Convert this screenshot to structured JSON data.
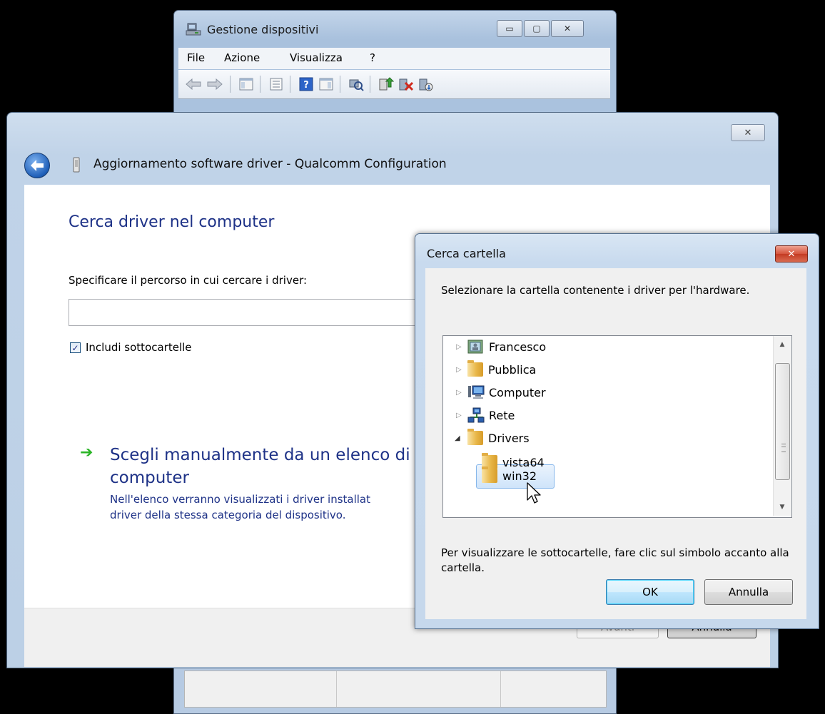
{
  "device_manager": {
    "title": "Gestione dispositivi",
    "menu": [
      "File",
      "Azione",
      "Visualizza",
      "?"
    ],
    "toolbar_icons": [
      "back-icon",
      "forward-icon",
      "console-tree-icon",
      "properties-icon",
      "help-icon",
      "action-pane-icon",
      "scan-hardware-icon",
      "update-driver-icon",
      "disable-device-icon",
      "uninstall-device-icon"
    ]
  },
  "wizard": {
    "title": "Aggiornamento software driver - Qualcomm Configuration",
    "heading": "Cerca driver nel computer",
    "path_label": "Specificare il percorso in cui cercare i driver:",
    "path_value": "",
    "include_subfolders_label": "Includi sottocartelle",
    "include_subfolders_checked": true,
    "option_title": "Scegli manualmente da un elenco di driver di dispositivo nel computer",
    "option_title_visible": "Scegli manualmente da un elenco di",
    "option_title_line2": "computer",
    "option_desc_line1": "Nell'elenco verranno visualizzati i driver installat",
    "option_desc_line2": "driver della stessa categoria del dispositivo.",
    "next_label": "Avanti",
    "cancel_label": "Annulla"
  },
  "browse_dialog": {
    "title": "Cerca cartella",
    "instruction": "Selezionare la cartella contenente i driver per l'hardware.",
    "tree": [
      {
        "label": "Francesco",
        "icon": "user-folder-icon",
        "expandable": true,
        "expanded": false,
        "level": 0
      },
      {
        "label": "Pubblica",
        "icon": "folder-icon",
        "expandable": true,
        "expanded": false,
        "level": 0
      },
      {
        "label": "Computer",
        "icon": "computer-icon",
        "expandable": true,
        "expanded": false,
        "level": 0
      },
      {
        "label": "Rete",
        "icon": "network-icon",
        "expandable": true,
        "expanded": false,
        "level": 0
      },
      {
        "label": "Drivers",
        "icon": "folder-icon",
        "expandable": true,
        "expanded": true,
        "level": 0
      },
      {
        "label": "vista64",
        "icon": "folder-icon",
        "expandable": false,
        "level": 1
      },
      {
        "label": "win32",
        "icon": "folder-icon",
        "expandable": false,
        "level": 1,
        "selected": true
      }
    ],
    "hint": "Per visualizzare le sottocartelle, fare clic sul simbolo accanto alla cartella.",
    "ok_label": "OK",
    "cancel_label": "Annulla"
  },
  "colors": {
    "link_blue": "#1e3287",
    "green_arrow": "#2bb527",
    "selection": "#cfe4fa"
  }
}
